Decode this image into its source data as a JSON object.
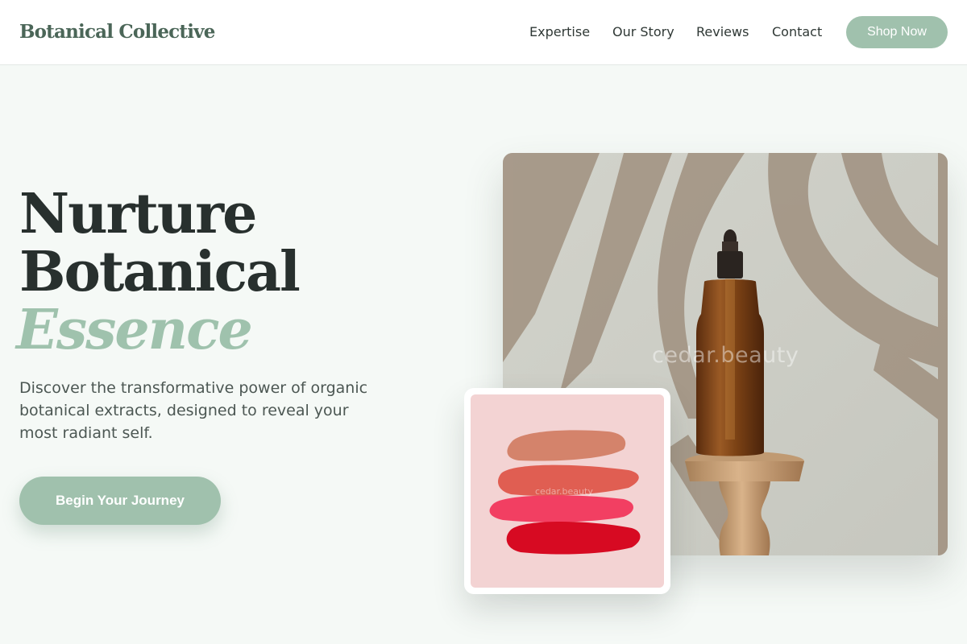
{
  "header": {
    "brand": "Botanical Collective",
    "nav": [
      "Expertise",
      "Our Story",
      "Reviews",
      "Contact"
    ],
    "shop_label": "Shop Now"
  },
  "hero": {
    "title_line1": "Nurture",
    "title_line2": "Botanical",
    "title_accent": "Essence",
    "subtitle": "Discover the transformative power of organic botanical extracts, designed to reveal your most radiant self.",
    "cta_label": "Begin Your Journey"
  },
  "images": {
    "main_watermark": "cedar.beauty",
    "swatch_watermark": "cedar.beauty"
  },
  "colors": {
    "accent": "#a0c1ad",
    "brand_text": "#4b6658",
    "background": "#f5f9f6"
  }
}
